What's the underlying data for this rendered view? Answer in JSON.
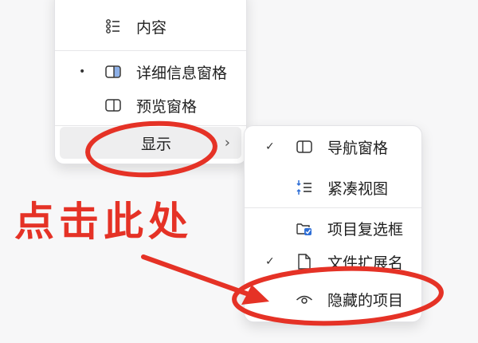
{
  "main_menu": {
    "items": [
      {
        "label": "内容",
        "icon": "details-list-icon"
      },
      {
        "label": "详细信息窗格",
        "icon": "details-pane-icon",
        "selected_marker": "•"
      },
      {
        "label": "预览窗格",
        "icon": "preview-pane-icon"
      },
      {
        "label": "显示",
        "submenu_arrow": "›"
      }
    ]
  },
  "sub_menu": {
    "items": [
      {
        "label": "导航窗格",
        "icon": "navigation-pane-icon",
        "check": "✓"
      },
      {
        "label": "紧凑视图",
        "icon": "compact-view-icon"
      },
      {
        "label": "项目复选框",
        "icon": "item-checkbox-icon"
      },
      {
        "label": "文件扩展名",
        "icon": "file-extension-icon",
        "check": "✓"
      },
      {
        "label": "隐藏的项目",
        "icon": "eye-icon"
      }
    ]
  },
  "annotation": {
    "text": "点击此处",
    "color": "#e53226"
  }
}
